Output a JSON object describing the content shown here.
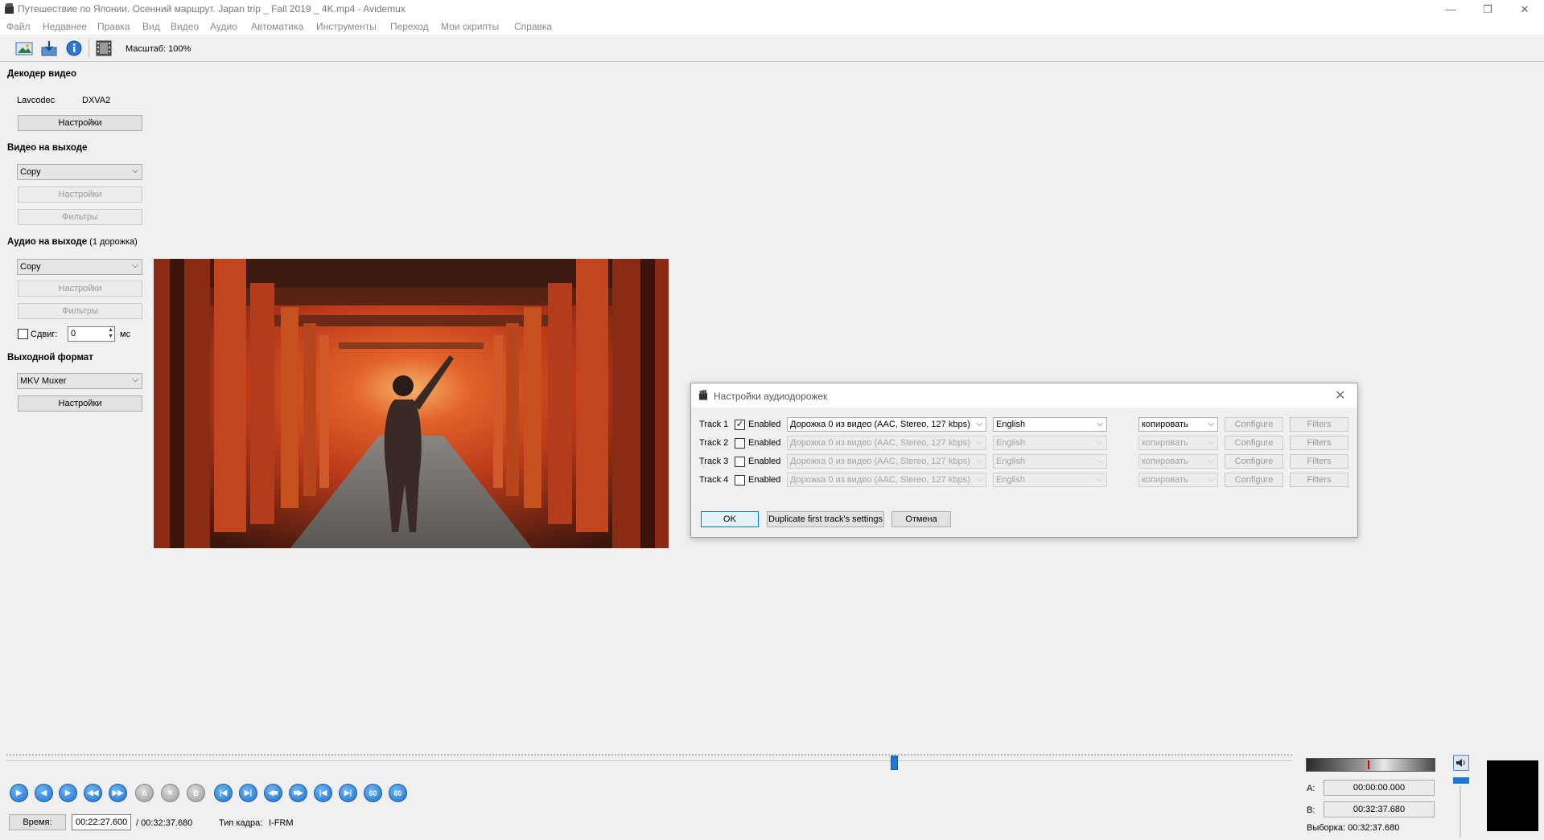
{
  "window": {
    "title": "Путешествие по Японии. Осенний маршрут. Japan trip _ Fall 2019 _ 4K.mp4 - Avidemux",
    "minimize": "—",
    "restore": "❐",
    "close": "✕"
  },
  "menu": [
    "Файл",
    "Недавнее",
    "Правка",
    "Вид",
    "Видео",
    "Аудио",
    "Автоматика",
    "Инструменты",
    "Переход",
    "Мои скрипты",
    "Справка"
  ],
  "toolbar": {
    "zoom_label": "Масштаб: 100%"
  },
  "decoder": {
    "title": "Декодер видео",
    "lavcodec": "Lavcodec",
    "dxva2": "DXVA2",
    "settings_button": "Настройки"
  },
  "video_output": {
    "title": "Видео на выходе",
    "codec": "Copy",
    "settings_button": "Настройки",
    "filters_button": "Фильтры"
  },
  "audio_output": {
    "title": "Аудио на выходе",
    "track_count": "(1 дорожка)",
    "codec": "Copy",
    "settings_button": "Настройки",
    "filters_button": "Фильтры",
    "shift_label": "Сдвиг:",
    "shift_value": "0",
    "shift_unit": "мс"
  },
  "output_format": {
    "title": "Выходной формат",
    "muxer": "MKV Muxer",
    "settings_button": "Настройки"
  },
  "dialog": {
    "title": "Настройки аудиодорожек",
    "close": "✕",
    "tracks": [
      {
        "label": "Track 1",
        "enabled_label": "Enabled",
        "enabled": true,
        "source": "Дорожка 0 из видео (AAC, Stereo, 127 kbps)",
        "language": "English",
        "codec": "копировать",
        "configure": "Configure",
        "filters": "Filters"
      },
      {
        "label": "Track 2",
        "enabled_label": "Enabled",
        "enabled": false,
        "source": "Дорожка 0 из видео (AAC, Stereo, 127 kbps)",
        "language": "English",
        "codec": "копировать",
        "configure": "Configure",
        "filters": "Filters"
      },
      {
        "label": "Track 3",
        "enabled_label": "Enabled",
        "enabled": false,
        "source": "Дорожка 0 из видео (AAC, Stereo, 127 kbps)",
        "language": "English",
        "codec": "копировать",
        "configure": "Configure",
        "filters": "Filters"
      },
      {
        "label": "Track 4",
        "enabled_label": "Enabled",
        "enabled": false,
        "source": "Дорожка 0 из видео (AAC, Stereo, 127 kbps)",
        "language": "English",
        "codec": "копировать",
        "configure": "Configure",
        "filters": "Filters"
      }
    ],
    "ok_button": "OK",
    "duplicate_button": "Duplicate first track's settings",
    "cancel_button": "Отмена"
  },
  "playback": {
    "time_label": "Время:",
    "current_time": "00:22:27.600",
    "total_time": "/ 00:32:37.680",
    "frame_type_label": "Тип кадра:",
    "frame_type": "I-FRM",
    "position_fraction": 0.69,
    "marker_a_label": "A:",
    "marker_a": "00:00:00.000",
    "marker_b_label": "B:",
    "marker_b": "00:32:37.680",
    "selection_label": "Выборка:",
    "selection": "00:32:37.680",
    "ctl_a_text": "A",
    "ctl_b_text": "B",
    "ctl_60_text": "60"
  }
}
